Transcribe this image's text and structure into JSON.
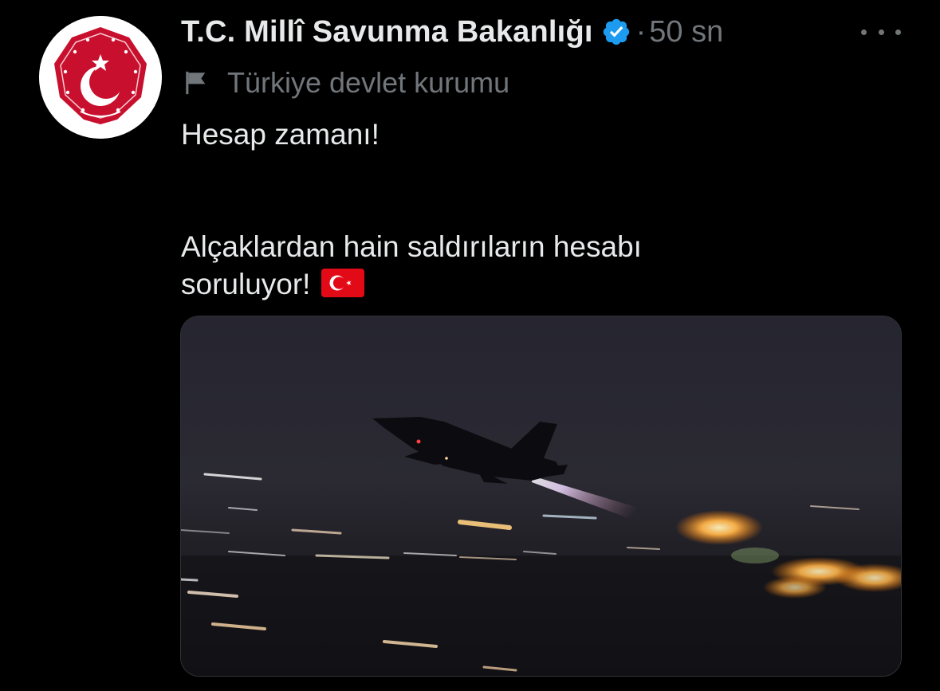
{
  "tweet": {
    "display_name": "T.C. Millî Savunma Bakanlığı",
    "verified_icon": "verified-badge-icon",
    "separator": "·",
    "time": "50 sn",
    "more_icon": "more-horizontal-icon",
    "affiliation_icon": "flag-icon",
    "affiliation": "Türkiye devlet kurumu",
    "text_line_1": "Hesap zamanı!",
    "text_line_2": "Alçaklardan hain saldırıların hesabı",
    "text_line_3": "soruluyor!",
    "emoji": "turkish-flag-emoji",
    "media": "photo of a fighter jet taking off at night with afterburner"
  },
  "colors": {
    "background": "#000000",
    "text_primary": "#e7e9ea",
    "text_secondary": "#71767b",
    "verified_blue": "#1d9bf0",
    "emblem_red": "#c8102e"
  }
}
